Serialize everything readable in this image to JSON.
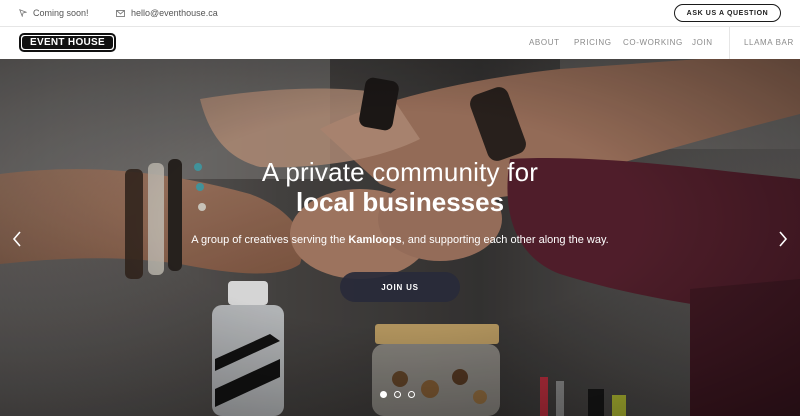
{
  "topbar": {
    "coming_soon": "Coming soon!",
    "email": "hello@eventhouse.ca",
    "ask_button": "ASK US A QUESTION"
  },
  "nav": {
    "logo": "EVENT HOUSE",
    "links": [
      "ABOUT",
      "PRICING",
      "CO-WORKING",
      "JOIN"
    ],
    "extra": "LLAMA BAR"
  },
  "hero": {
    "title_line1": "A private community for",
    "title_line2": "local businesses",
    "subtitle_pre": "A group of creatives serving the ",
    "subtitle_bold": "Kamloops",
    "subtitle_post": ", and supporting each other along the way.",
    "cta": "JOIN US",
    "slides_active": 1
  },
  "icons": {
    "location": "location-arrow-icon",
    "email": "envelope-icon",
    "prev": "chevron-left-icon",
    "next": "chevron-right-icon"
  }
}
